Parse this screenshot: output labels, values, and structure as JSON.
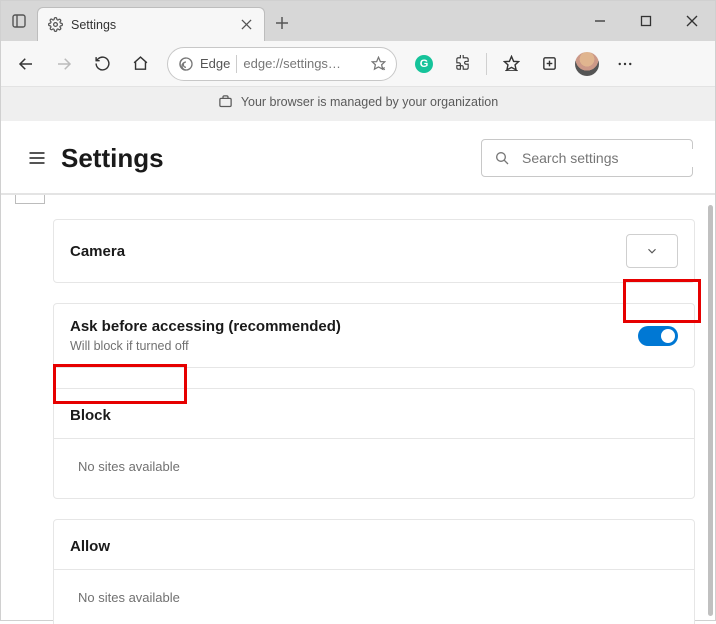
{
  "window": {
    "tab_title": "Settings",
    "address_label": "Edge",
    "address_url": "edge://settings…"
  },
  "banner": {
    "text": "Your browser is managed by your organization"
  },
  "header": {
    "title": "Settings",
    "search_placeholder": "Search settings"
  },
  "camera_section": {
    "title": "Camera"
  },
  "ask_section": {
    "title": "Ask before accessing (recommended)",
    "subtitle": "Will block if turned off",
    "enabled": true
  },
  "block_section": {
    "title": "Block",
    "empty_text": "No sites available"
  },
  "allow_section": {
    "title": "Allow",
    "empty_text": "No sites available"
  }
}
